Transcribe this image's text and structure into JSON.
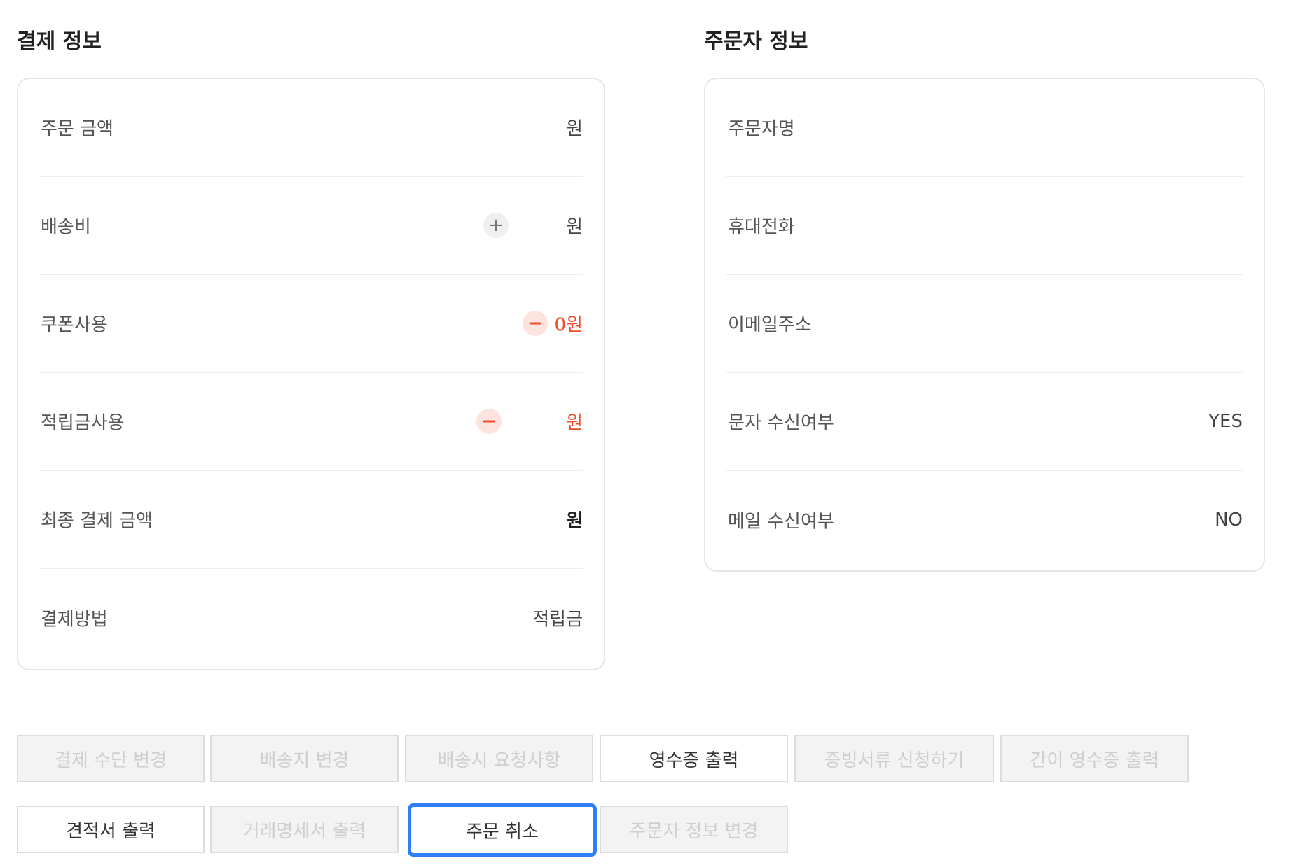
{
  "payment": {
    "title": "결제 정보",
    "rows": [
      {
        "label": "주문 금액",
        "value": "원"
      },
      {
        "label": "배송비",
        "value": "원",
        "action": "+"
      },
      {
        "label": "쿠폰사용",
        "value": "0원",
        "action": "−"
      },
      {
        "label": "적립금사용",
        "value": "원",
        "action": "−"
      },
      {
        "label": "최종 결제 금액",
        "value": "원"
      },
      {
        "label": "결제방법",
        "value": "적립금"
      }
    ]
  },
  "orderer": {
    "title": "주문자 정보",
    "rows": [
      {
        "label": "주문자명",
        "value": ""
      },
      {
        "label": "휴대전화",
        "value": ""
      },
      {
        "label": "이메일주소",
        "value": ""
      },
      {
        "label": "문자 수신여부",
        "value": "YES"
      },
      {
        "label": "메일 수신여부",
        "value": "NO"
      }
    ]
  },
  "buttons": {
    "change_payment": "결제 수단 변경",
    "change_address": "배송지 변경",
    "delivery_request": "배송시 요청사항",
    "print_receipt": "영수증 출력",
    "request_documents": "증빙서류 신청하기",
    "print_simple_receipt": "간이 영수증 출력",
    "print_quote": "견적서 출력",
    "print_statement": "거래명세서 출력",
    "cancel_order": "주문 취소",
    "change_orderer": "주문자 정보 변경"
  },
  "colors": {
    "accent_red": "#f24c2c",
    "focus_blue": "#2f7ef5"
  }
}
